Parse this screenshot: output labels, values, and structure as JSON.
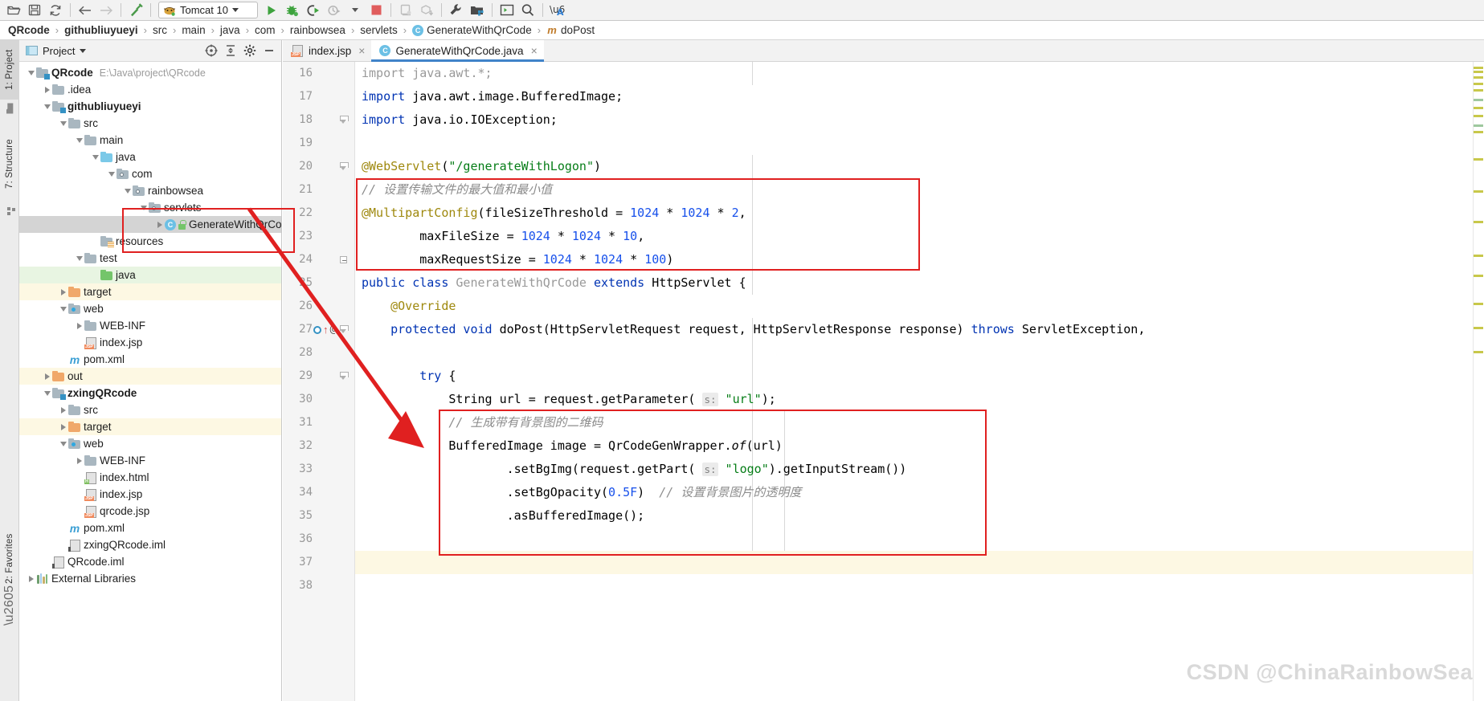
{
  "toolbar": {
    "buttons": [
      {
        "name": "open-folder-icon",
        "glyph": "open-folder"
      },
      {
        "name": "save-all-icon",
        "glyph": "save"
      },
      {
        "name": "sync-refresh-icon",
        "glyph": "refresh"
      },
      {
        "name": "back-icon",
        "glyph": "arrow-left"
      },
      {
        "name": "forward-icon",
        "glyph": "arrow-right"
      },
      {
        "name": "build-hammer-icon",
        "glyph": "hammer"
      }
    ],
    "run_config": {
      "label": "Tomcat 10",
      "icon": "tomcat-icon",
      "dropdown": "chevron-down-icon"
    },
    "run_buttons": [
      {
        "name": "run-icon",
        "glyph": "play"
      },
      {
        "name": "debug-icon",
        "glyph": "bug"
      },
      {
        "name": "run-with-coverage-icon",
        "glyph": "coverage"
      },
      {
        "name": "profile-icon",
        "glyph": "profiler"
      },
      {
        "name": "stop-icon",
        "glyph": "stop"
      }
    ],
    "right_buttons": [
      {
        "name": "update-app-icon",
        "glyph": "update-app"
      },
      {
        "name": "package-download-icon",
        "glyph": "package-down"
      },
      {
        "name": "settings-wrench-icon",
        "glyph": "wrench"
      },
      {
        "name": "project-structure-icon",
        "glyph": "project-structure"
      },
      {
        "name": "terminal-icon",
        "glyph": "terminal"
      },
      {
        "name": "search-everywhere-icon",
        "glyph": "magnifier"
      },
      {
        "name": "translate-icon",
        "glyph": "translate"
      }
    ]
  },
  "breadcrumbs": [
    {
      "label": "QRcode",
      "bold": true,
      "icon": null
    },
    {
      "label": "githubliuyueyi",
      "bold": true,
      "icon": null
    },
    {
      "label": "src",
      "bold": false,
      "icon": null
    },
    {
      "label": "main",
      "bold": false,
      "icon": null
    },
    {
      "label": "java",
      "bold": false,
      "icon": null
    },
    {
      "label": "com",
      "bold": false,
      "icon": null
    },
    {
      "label": "rainbowsea",
      "bold": false,
      "icon": null
    },
    {
      "label": "servlets",
      "bold": false,
      "icon": null
    },
    {
      "label": "GenerateWithQrCode",
      "bold": false,
      "icon": "class-icon"
    },
    {
      "label": "doPost",
      "bold": false,
      "icon": "method-icon"
    }
  ],
  "breadcrumb_separator": "›",
  "left_strip": [
    {
      "label": "1: Project",
      "selected": true
    },
    {
      "label": "7: Structure",
      "selected": false
    },
    {
      "label": "2: Favorites",
      "selected": false
    }
  ],
  "project_panel": {
    "title": "Project",
    "title_dropdown": "chevron-down-icon",
    "header_icons": [
      {
        "name": "scroll-from-source-icon"
      },
      {
        "name": "collapse-all-icon"
      },
      {
        "name": "settings-gear-icon"
      },
      {
        "name": "hide-panel-icon"
      }
    ],
    "tree": [
      {
        "indent": 0,
        "arrow": "open",
        "icon": "module-folder",
        "label": "QRcode",
        "bold": true,
        "path": "E:\\Java\\project\\QRcode",
        "row": "plain"
      },
      {
        "indent": 1,
        "arrow": "closed",
        "icon": "folder",
        "label": ".idea",
        "bold": false,
        "row": "plain"
      },
      {
        "indent": 1,
        "arrow": "open",
        "icon": "module-folder",
        "label": "githubliuyueyi",
        "bold": true,
        "row": "plain"
      },
      {
        "indent": 2,
        "arrow": "open",
        "icon": "folder",
        "label": "src",
        "bold": false,
        "row": "plain"
      },
      {
        "indent": 3,
        "arrow": "open",
        "icon": "folder",
        "label": "main",
        "bold": false,
        "row": "plain"
      },
      {
        "indent": 4,
        "arrow": "open",
        "icon": "folder-blue",
        "label": "java",
        "bold": false,
        "row": "plain"
      },
      {
        "indent": 5,
        "arrow": "open",
        "icon": "pkg-folder",
        "label": "com",
        "bold": false,
        "row": "plain"
      },
      {
        "indent": 6,
        "arrow": "open",
        "icon": "pkg-folder",
        "label": "rainbowsea",
        "bold": false,
        "row": "plain"
      },
      {
        "indent": 7,
        "arrow": "open",
        "icon": "pkg-folder",
        "label": "servlets",
        "bold": false,
        "row": "plain"
      },
      {
        "indent": 8,
        "arrow": "closed",
        "icon": "java-class",
        "label": "GenerateWithQrCo",
        "bold": false,
        "row": "selected"
      },
      {
        "indent": 4,
        "arrow": "none",
        "icon": "resources-folder",
        "label": "resources",
        "bold": false,
        "row": "plain"
      },
      {
        "indent": 3,
        "arrow": "open",
        "icon": "folder",
        "label": "test",
        "bold": false,
        "row": "plain"
      },
      {
        "indent": 4,
        "arrow": "none",
        "icon": "folder-green",
        "label": "java",
        "bold": false,
        "row": "green"
      },
      {
        "indent": 2,
        "arrow": "closed",
        "icon": "folder-orange",
        "label": "target",
        "bold": false,
        "row": "yellow"
      },
      {
        "indent": 2,
        "arrow": "open",
        "icon": "web-folder",
        "label": "web",
        "bold": false,
        "row": "plain"
      },
      {
        "indent": 3,
        "arrow": "closed",
        "icon": "folder",
        "label": "WEB-INF",
        "bold": false,
        "row": "plain"
      },
      {
        "indent": 3,
        "arrow": "none",
        "icon": "jsp-file",
        "label": "index.jsp",
        "bold": false,
        "row": "plain"
      },
      {
        "indent": 2,
        "arrow": "none",
        "icon": "maven-file",
        "label": "pom.xml",
        "bold": false,
        "row": "plain"
      },
      {
        "indent": 1,
        "arrow": "closed",
        "icon": "folder-orange",
        "label": "out",
        "bold": false,
        "row": "yellow"
      },
      {
        "indent": 1,
        "arrow": "open",
        "icon": "module-folder",
        "label": "zxingQRcode",
        "bold": true,
        "row": "plain"
      },
      {
        "indent": 2,
        "arrow": "closed",
        "icon": "folder",
        "label": "src",
        "bold": false,
        "row": "plain"
      },
      {
        "indent": 2,
        "arrow": "closed",
        "icon": "folder-orange",
        "label": "target",
        "bold": false,
        "row": "yellow"
      },
      {
        "indent": 2,
        "arrow": "open",
        "icon": "web-folder",
        "label": "web",
        "bold": false,
        "row": "plain"
      },
      {
        "indent": 3,
        "arrow": "closed",
        "icon": "folder",
        "label": "WEB-INF",
        "bold": false,
        "row": "plain"
      },
      {
        "indent": 3,
        "arrow": "none",
        "icon": "html-file",
        "label": "index.html",
        "bold": false,
        "row": "plain"
      },
      {
        "indent": 3,
        "arrow": "none",
        "icon": "jsp-file",
        "label": "index.jsp",
        "bold": false,
        "row": "plain"
      },
      {
        "indent": 3,
        "arrow": "none",
        "icon": "jsp-file",
        "label": "qrcode.jsp",
        "bold": false,
        "row": "plain"
      },
      {
        "indent": 2,
        "arrow": "none",
        "icon": "maven-file",
        "label": "pom.xml",
        "bold": false,
        "row": "plain"
      },
      {
        "indent": 2,
        "arrow": "none",
        "icon": "iml-file",
        "label": "zxingQRcode.iml",
        "bold": false,
        "row": "plain"
      },
      {
        "indent": 1,
        "arrow": "none",
        "icon": "iml-file",
        "label": "QRcode.iml",
        "bold": false,
        "row": "plain"
      },
      {
        "indent": 0,
        "arrow": "closed",
        "icon": "libraries",
        "label": "External Libraries",
        "bold": false,
        "row": "plain"
      }
    ]
  },
  "editor": {
    "tabs": [
      {
        "label": "index.jsp",
        "icon": "jsp-file-icon",
        "active": false,
        "close": "×"
      },
      {
        "label": "GenerateWithQrCode.java",
        "icon": "class-icon",
        "active": true,
        "close": "×"
      }
    ],
    "first_line_number": 16,
    "lines": [
      {
        "num": 16,
        "fold": "none",
        "tokens": [
          {
            "t": "import java.awt.*;",
            "c": "g"
          }
        ]
      },
      {
        "num": 17,
        "fold": "none",
        "tokens": [
          {
            "t": "import ",
            "c": "k"
          },
          {
            "t": "java.awt.image.BufferedImage;",
            "c": "t"
          }
        ]
      },
      {
        "num": 18,
        "fold": "tick",
        "tokens": [
          {
            "t": "import ",
            "c": "k"
          },
          {
            "t": "java.io.IOException;",
            "c": "t"
          }
        ]
      },
      {
        "num": 19,
        "fold": "none",
        "tokens": []
      },
      {
        "num": 20,
        "fold": "tick",
        "tokens": [
          {
            "t": "@WebServlet",
            "c": "a"
          },
          {
            "t": "(",
            "c": "t"
          },
          {
            "t": "\"/generateWithLogon\"",
            "c": "s"
          },
          {
            "t": ")",
            "c": "t"
          }
        ]
      },
      {
        "num": 21,
        "fold": "none",
        "tokens": [
          {
            "t": "// 设置传输文件的最大值和最小值",
            "c": "cm"
          }
        ]
      },
      {
        "num": 22,
        "fold": "none",
        "tokens": [
          {
            "t": "@MultipartConfig",
            "c": "a"
          },
          {
            "t": "(fileSizeThreshold = ",
            "c": "t"
          },
          {
            "t": "1024",
            "c": "n"
          },
          {
            "t": " * ",
            "c": "t"
          },
          {
            "t": "1024",
            "c": "n"
          },
          {
            "t": " * ",
            "c": "t"
          },
          {
            "t": "2",
            "c": "n"
          },
          {
            "t": ",",
            "c": "t"
          }
        ]
      },
      {
        "num": 23,
        "fold": "none",
        "tokens": [
          {
            "t": "        maxFileSize = ",
            "c": "t"
          },
          {
            "t": "1024",
            "c": "n"
          },
          {
            "t": " * ",
            "c": "t"
          },
          {
            "t": "1024",
            "c": "n"
          },
          {
            "t": " * ",
            "c": "t"
          },
          {
            "t": "10",
            "c": "n"
          },
          {
            "t": ",",
            "c": "t"
          }
        ]
      },
      {
        "num": 24,
        "fold": "tickend",
        "tokens": [
          {
            "t": "        maxRequestSize = ",
            "c": "t"
          },
          {
            "t": "1024",
            "c": "n"
          },
          {
            "t": " * ",
            "c": "t"
          },
          {
            "t": "1024",
            "c": "n"
          },
          {
            "t": " * ",
            "c": "t"
          },
          {
            "t": "100",
            "c": "n"
          },
          {
            "t": ")",
            "c": "t"
          }
        ]
      },
      {
        "num": 25,
        "fold": "none",
        "tokens": [
          {
            "t": "public class ",
            "c": "k"
          },
          {
            "t": "GenerateWithQrCode",
            "c": "g"
          },
          {
            "t": " ",
            "c": "t"
          },
          {
            "t": "extends",
            "c": "k"
          },
          {
            "t": " HttpServlet {",
            "c": "t"
          }
        ]
      },
      {
        "num": 26,
        "fold": "none",
        "tokens": [
          {
            "t": "    @Override",
            "c": "a"
          }
        ]
      },
      {
        "num": 27,
        "fold": "tick",
        "marks": [
          "override-gutter-icon",
          "up-arrow-icon",
          "at-icon"
        ],
        "tokens": [
          {
            "t": "    ",
            "c": "t"
          },
          {
            "t": "protected void ",
            "c": "k"
          },
          {
            "t": "doPost",
            "c": "t"
          },
          {
            "t": "(HttpServletRequest request, HttpServletResponse response) ",
            "c": "t"
          },
          {
            "t": "throws",
            "c": "k"
          },
          {
            "t": " ServletException,",
            "c": "t"
          }
        ]
      },
      {
        "num": 28,
        "fold": "none",
        "tokens": []
      },
      {
        "num": 29,
        "fold": "tick",
        "tokens": [
          {
            "t": "        ",
            "c": "t"
          },
          {
            "t": "try",
            "c": "k"
          },
          {
            "t": " {",
            "c": "t"
          }
        ]
      },
      {
        "num": 30,
        "fold": "none",
        "tokens": [
          {
            "t": "            String url = request.getParameter( ",
            "c": "t"
          },
          {
            "t": "s:",
            "c": "hint"
          },
          {
            "t": " ",
            "c": "t"
          },
          {
            "t": "\"url\"",
            "c": "s"
          },
          {
            "t": ");",
            "c": "t"
          }
        ]
      },
      {
        "num": 31,
        "fold": "none",
        "tokens": [
          {
            "t": "            // 生成带有背景图的二维码",
            "c": "cm"
          }
        ]
      },
      {
        "num": 32,
        "fold": "none",
        "tokens": [
          {
            "t": "            BufferedImage image = QrCodeGenWrapper.",
            "c": "t"
          },
          {
            "t": "of",
            "c": "t it"
          },
          {
            "t": "(url)",
            "c": "t"
          }
        ]
      },
      {
        "num": 33,
        "fold": "none",
        "tokens": [
          {
            "t": "                    .setBgImg(request.getPart( ",
            "c": "t"
          },
          {
            "t": "s:",
            "c": "hint"
          },
          {
            "t": " ",
            "c": "t"
          },
          {
            "t": "\"logo\"",
            "c": "s"
          },
          {
            "t": ").getInputStream())",
            "c": "t"
          }
        ]
      },
      {
        "num": 34,
        "fold": "none",
        "tokens": [
          {
            "t": "                    .setBgOpacity(",
            "c": "t"
          },
          {
            "t": "0.5F",
            "c": "n"
          },
          {
            "t": ")  ",
            "c": "t"
          },
          {
            "t": "// 设置背景图片的透明度",
            "c": "cm"
          }
        ]
      },
      {
        "num": 35,
        "fold": "none",
        "tokens": [
          {
            "t": "                    .asBufferedImage();",
            "c": "t"
          }
        ]
      },
      {
        "num": 36,
        "fold": "none",
        "tokens": []
      },
      {
        "num": 37,
        "fold": "none",
        "highlight": true,
        "tokens": []
      },
      {
        "num": 38,
        "fold": "none",
        "tokens": []
      }
    ]
  },
  "annotations": {
    "rect_top": {
      "name": "multipart-config-highlight",
      "color": "#e02020"
    },
    "rect_bottom": {
      "name": "qrcode-generation-highlight",
      "color": "#e02020"
    },
    "rect_tree": {
      "name": "servlet-class-highlight",
      "color": "#e02020"
    },
    "arrow": {
      "name": "red-pointer-arrow",
      "color": "#e02020"
    }
  },
  "watermark": "CSDN @ChinaRainbowSea",
  "colors": {
    "accent": "#4083c9",
    "annotation_red": "#e02020",
    "keyword_blue": "#0033b3",
    "string_green": "#067d17",
    "number_blue": "#1750eb",
    "annotation_gold": "#9e880d",
    "comment_gray": "#8c8c8c",
    "selection_gray": "#d4d4d4",
    "row_green": "#e8f5e2",
    "row_yellow": "#fdf8e3"
  }
}
